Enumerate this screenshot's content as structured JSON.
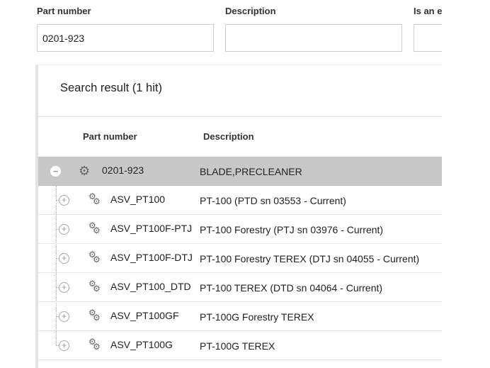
{
  "filters": {
    "part_number": {
      "label": "Part number",
      "value": "0201-923"
    },
    "description": {
      "label": "Description",
      "value": ""
    },
    "equivalent": {
      "label": "Is an e"
    }
  },
  "results": {
    "title": "Search result (1 hit)",
    "columns": {
      "part_number": "Part number",
      "description": "Description"
    },
    "parent": {
      "part_number": "0201-923",
      "description": "BLADE,PRECLEANER",
      "expanded": true,
      "icon": "gear-icon"
    },
    "children": [
      {
        "part_number": "ASV_PT100",
        "description": "PT-100 (PTD sn 03553 - Current)",
        "icon": "gears-icon"
      },
      {
        "part_number": "ASV_PT100F-PTJ",
        "description": "PT-100 Forestry (PTJ sn 03976 - Current)",
        "icon": "gears-icon"
      },
      {
        "part_number": "ASV_PT100F-DTJ",
        "description": "PT-100 Forestry TEREX (DTJ sn 04055 - Current)",
        "icon": "gears-icon"
      },
      {
        "part_number": "ASV_PT100_DTD",
        "description": "PT-100 TEREX (DTD sn 04064 - Current)",
        "icon": "gears-icon"
      },
      {
        "part_number": "ASV_PT100GF",
        "description": "PT-100G Forestry TEREX",
        "icon": "gears-icon"
      },
      {
        "part_number": "ASV_PT100G",
        "description": "PT-100G TEREX",
        "icon": "gears-icon"
      }
    ]
  },
  "colors": {
    "selected_row": "#c8c8c8",
    "border": "#cfcfcf",
    "panel_edge": "#e3e3e3"
  }
}
